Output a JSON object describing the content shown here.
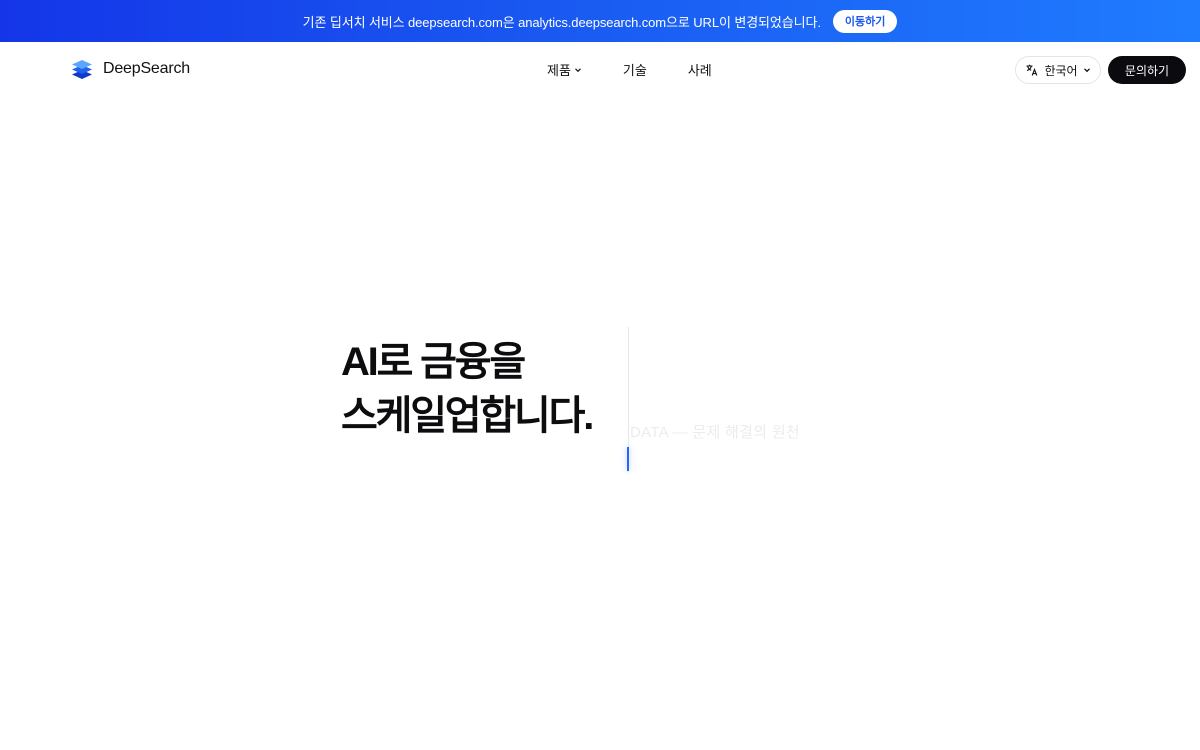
{
  "banner": {
    "message": "기존 딥서치 서비스 deepsearch.com은 analytics.deepsearch.com으로 URL이 변경되었습니다.",
    "button_label": "이동하기"
  },
  "header": {
    "logo_text": "DeepSearch",
    "nav": [
      {
        "label": "제품",
        "has_dropdown": true
      },
      {
        "label": "기술",
        "has_dropdown": false
      },
      {
        "label": "사례",
        "has_dropdown": false
      }
    ],
    "language": {
      "label": "한국어",
      "icon": "translate-icon"
    },
    "contact_label": "문의하기"
  },
  "hero": {
    "title_line1": "AI로 금융을",
    "title_line2": "스케일업합니다.",
    "rotating_text": "DATA — 문제 해결의 원천"
  },
  "colors": {
    "banner_start": "#1436e8",
    "banner_end": "#1f7cff",
    "primary_button": "#0b0b0f",
    "caret": "#2a66f5"
  }
}
